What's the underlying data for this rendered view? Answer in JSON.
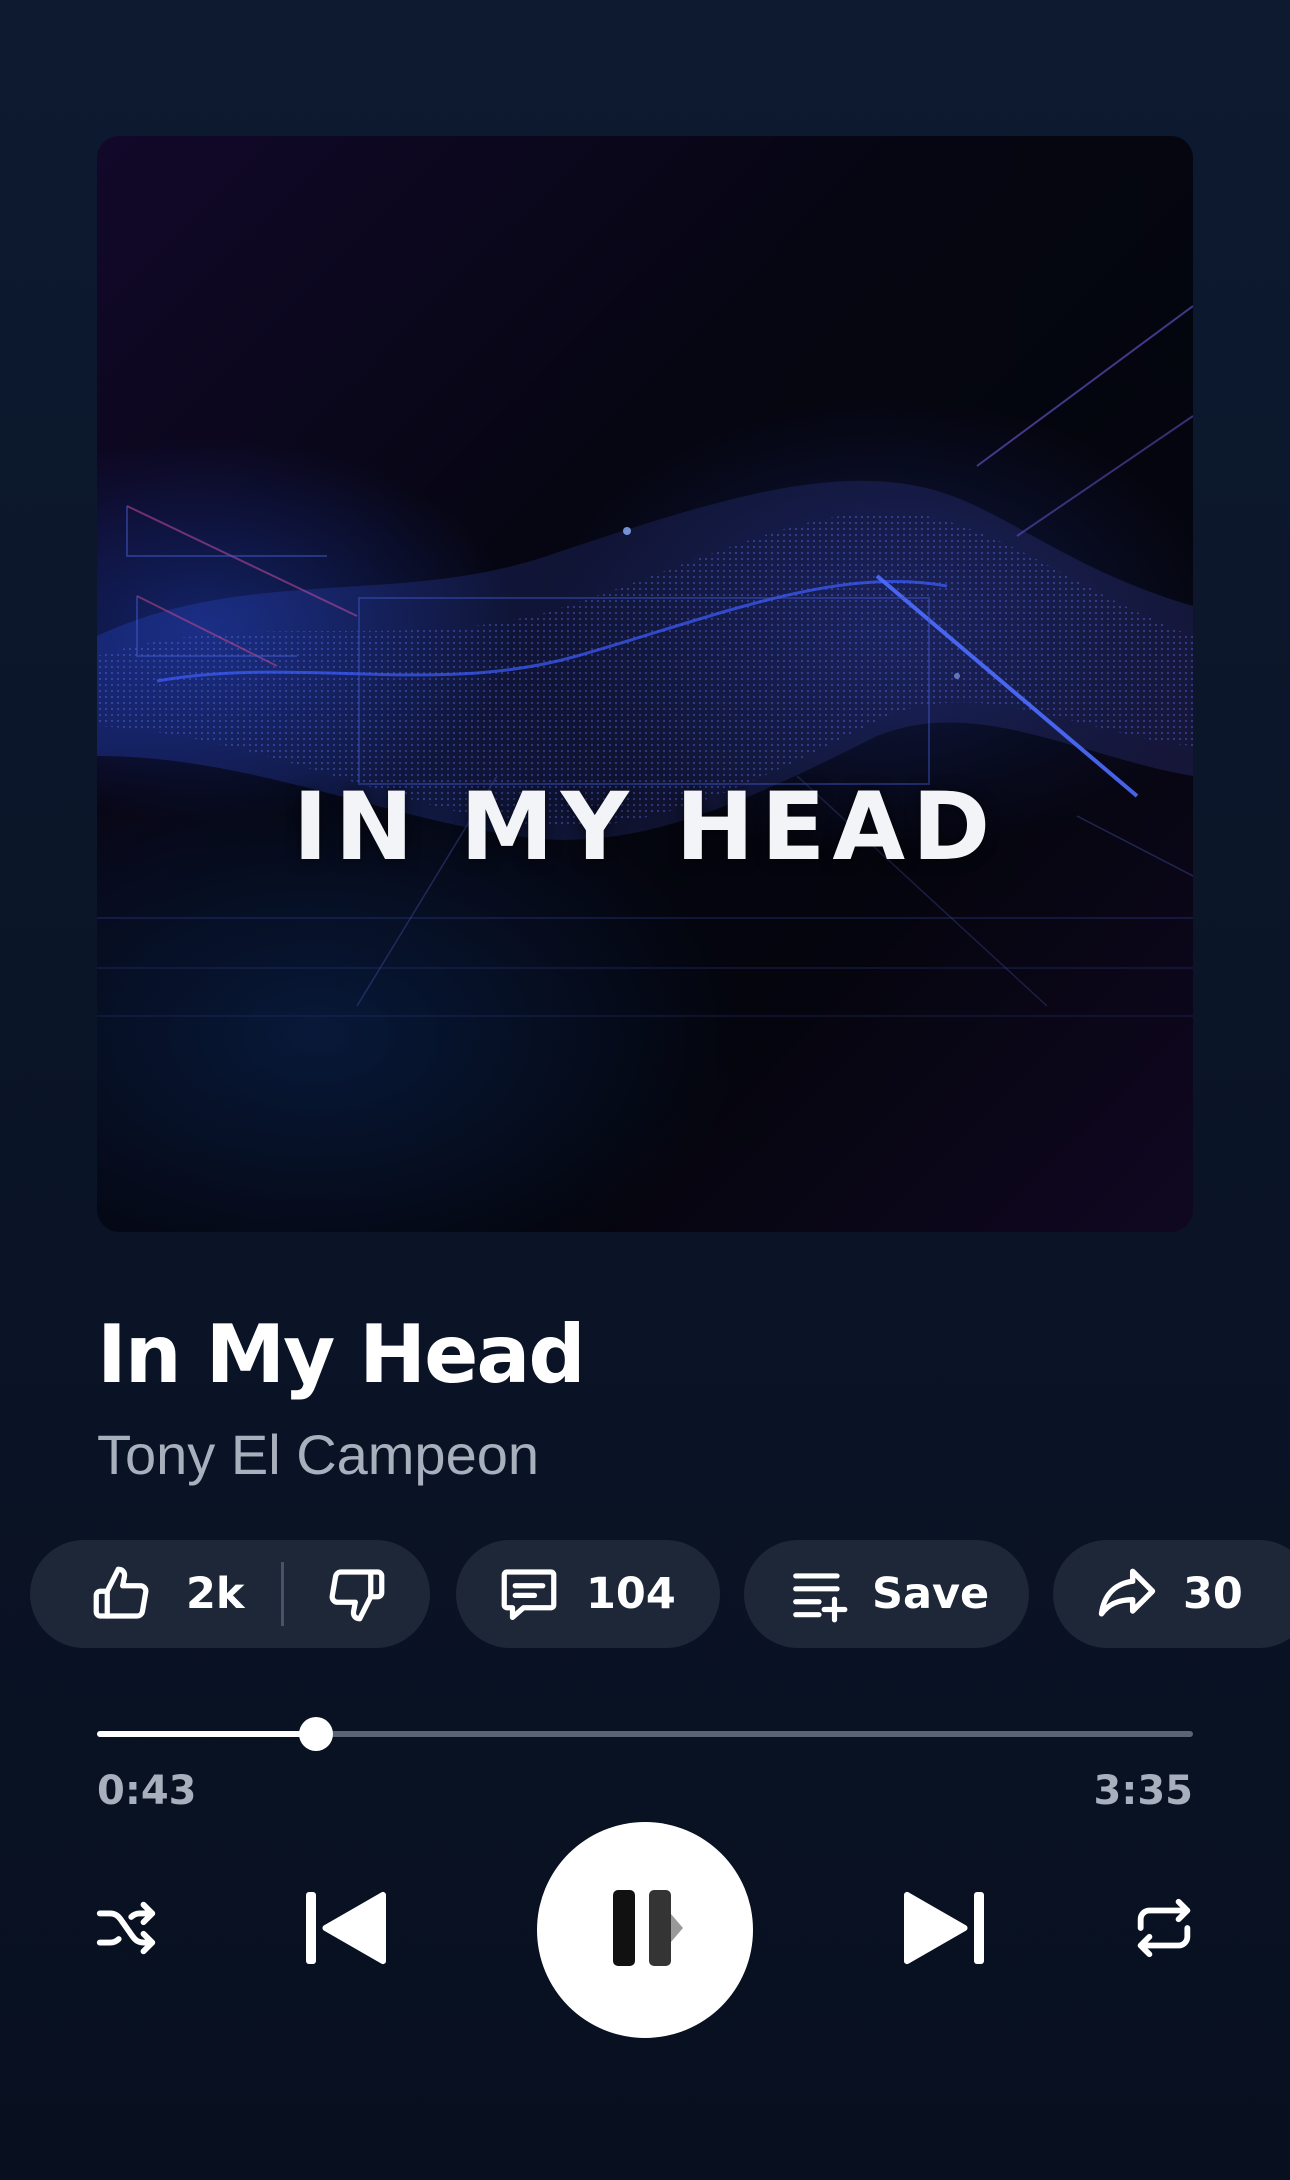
{
  "album_art": {
    "title": "IN MY HEAD"
  },
  "song": {
    "title": "In My Head",
    "artist": "Tony El Campeon"
  },
  "actions": {
    "likes": "2k",
    "comments": "104",
    "save_label": "Save",
    "shares": "30"
  },
  "progress": {
    "elapsed": "0:43",
    "total": "3:35",
    "fraction": 0.2
  },
  "controls": {
    "shuffle_icon": "shuffle-icon",
    "previous_icon": "skip-previous-icon",
    "play_pause_icon": "pause-icon",
    "next_icon": "skip-next-icon",
    "repeat_icon": "repeat-icon"
  },
  "colors": {
    "background": "#0b1528",
    "chip": "#1e2738",
    "muted_text": "#a8afbd",
    "track": "#5b6475",
    "accent": "#ffffff"
  }
}
